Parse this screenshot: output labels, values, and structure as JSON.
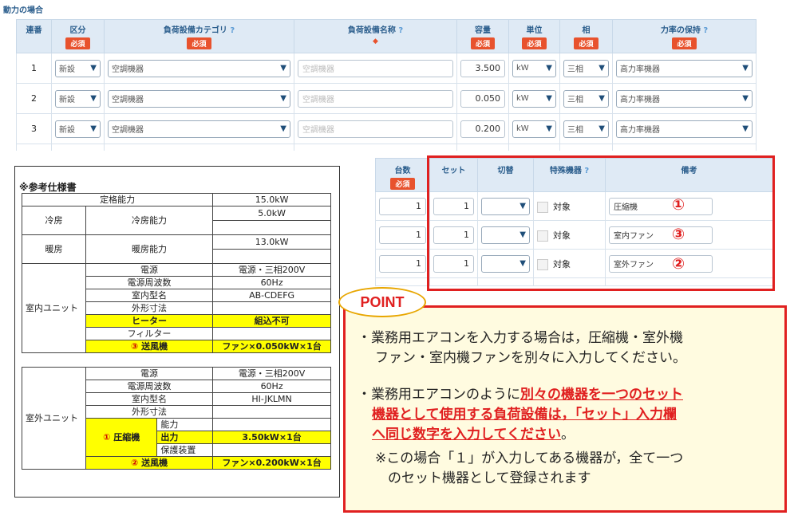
{
  "form": {
    "section_title": "動力の場合",
    "headers": {
      "serial": "連番",
      "kubun": "区分",
      "category": "負荷設備カテゴリ",
      "name": "負荷設備名称",
      "capacity": "容量",
      "unit": "単位",
      "phase": "相",
      "pf": "力率の保持",
      "required": "必須",
      "help": "?",
      "diamond": "◆"
    },
    "rows": [
      {
        "no": "1",
        "kubun": "新設",
        "category": "空調機器",
        "name_placeholder": "空調機器",
        "capacity": "3.500",
        "unit": "kW",
        "phase": "三相",
        "pf": "高力率機器"
      },
      {
        "no": "2",
        "kubun": "新設",
        "category": "空調機器",
        "name_placeholder": "空調機器",
        "capacity": "0.050",
        "unit": "kW",
        "phase": "三相",
        "pf": "高力率機器"
      },
      {
        "no": "3",
        "kubun": "新設",
        "category": "空調機器",
        "name_placeholder": "空調機器",
        "capacity": "0.200",
        "unit": "kW",
        "phase": "三相",
        "pf": "高力率機器"
      }
    ]
  },
  "spec": {
    "title": "※参考仕様書",
    "rated_capacity": "定格能力",
    "rated_value": "15.0kW",
    "cooling": "冷房",
    "cooling_capacity": "冷房能力",
    "cooling_value": "5.0kW",
    "heating": "暖房",
    "heating_capacity": "暖房能力",
    "heating_value": "13.0kW",
    "indoor": "室内ユニット",
    "outdoor": "室外ユニット",
    "power": "電源",
    "power_value": "電源・三相200V",
    "freq": "電源周波数",
    "freq_value": "60Hz",
    "model": "室内型名",
    "indoor_model": "AB-CDEFG",
    "outdoor_model": "HI-JKLMN",
    "dimensions": "外形寸法",
    "heater": "ヒーター",
    "heater_value": "組込不可",
    "filter": "フィルター",
    "fan": "送風機",
    "fan_indoor_value": "ファン×0.050kW×1台",
    "fan_outdoor_value": "ファン×0.200kW×1台",
    "compressor": "圧縮機",
    "capability": "能力",
    "output": "出力",
    "output_value": "3.50kW×1台",
    "protection": "保護装置",
    "circ1": "①",
    "circ2": "②",
    "circ3": "③"
  },
  "sub": {
    "headers": {
      "count": "台数",
      "required": "必須",
      "set": "セット",
      "switch": "切替",
      "special": "特殊機器",
      "help": "?",
      "note": "備考"
    },
    "rows": [
      {
        "count": "1",
        "set": "1",
        "target": "対象",
        "note": "圧縮機",
        "mark": "①"
      },
      {
        "count": "1",
        "set": "1",
        "target": "対象",
        "note": "室内ファン",
        "mark": "③"
      },
      {
        "count": "1",
        "set": "1",
        "target": "対象",
        "note": "室外ファン",
        "mark": "②"
      }
    ]
  },
  "point": {
    "label": "POINT",
    "p1_line1": "・業務用エアコンを入力する場合は，圧縮機・室外機",
    "p1_line2": "ファン・室内機ファンを別々に入力してください。",
    "p2_line1_a": "・業務用エアコンのように",
    "p2_line1_b": "別々の機器を一つのセット",
    "p2_line2": "機器として使用する負荷設備は，「セット」入力欄",
    "p2_line3_a": "へ同じ数字を入力してください",
    "p2_line3_b": "。",
    "p3_line1": "※この場合「１」が入力してある機器が，全て一つ",
    "p3_line2": "のセット機器として登録されます"
  }
}
